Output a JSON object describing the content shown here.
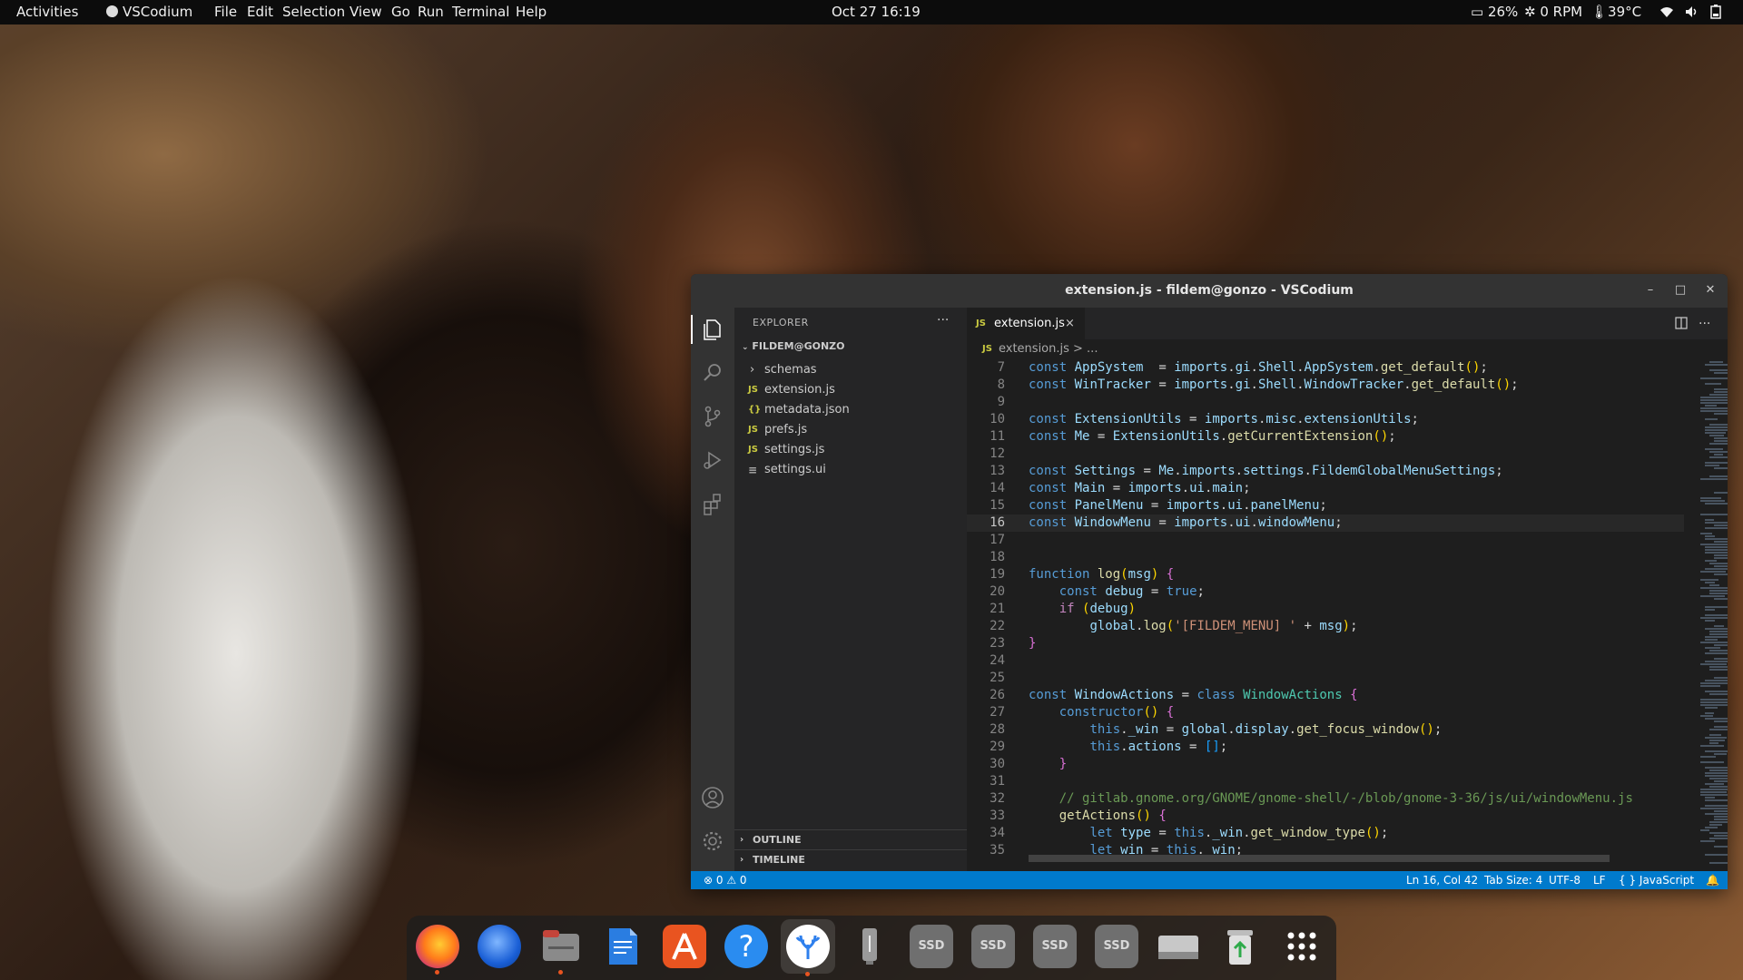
{
  "topbar": {
    "activities": "Activities",
    "app_name": "VSCodium",
    "menu": [
      "File",
      "Edit",
      "Selection",
      "View",
      "Go",
      "Run",
      "Terminal",
      "Help"
    ],
    "clock": "Oct 27  16:19",
    "battery": "26%",
    "fan": "0 RPM",
    "temp": "39°C"
  },
  "window": {
    "title": "extension.js - fildem@gonzo - VSCodium"
  },
  "sidebar": {
    "header": "EXPLORER",
    "more": "···",
    "folder": "FILDEM@GONZO",
    "items": [
      {
        "icon": "›",
        "label": "schemas",
        "type": "folder"
      },
      {
        "icon": "JS",
        "label": "extension.js",
        "type": "js"
      },
      {
        "icon": "{}",
        "label": "metadata.json",
        "type": "json"
      },
      {
        "icon": "JS",
        "label": "prefs.js",
        "type": "js"
      },
      {
        "icon": "JS",
        "label": "settings.js",
        "type": "js"
      },
      {
        "icon": "≡",
        "label": "settings.ui",
        "type": "ui"
      }
    ],
    "outline": "OUTLINE",
    "timeline": "TIMELINE"
  },
  "tabs": [
    {
      "icon": "JS",
      "label": "extension.js",
      "close": "×"
    }
  ],
  "breadcrumb": {
    "icon": "JS",
    "text": "extension.js > ..."
  },
  "editor": {
    "current_line": 16,
    "lines": [
      {
        "no": "7",
        "code": "const AppSystem  = imports.gi.Shell.AppSystem.get_default();"
      },
      {
        "no": "8",
        "code": "const WinTracker = imports.gi.Shell.WindowTracker.get_default();"
      },
      {
        "no": "9",
        "code": ""
      },
      {
        "no": "10",
        "code": "const ExtensionUtils = imports.misc.extensionUtils;"
      },
      {
        "no": "11",
        "code": "const Me = ExtensionUtils.getCurrentExtension();"
      },
      {
        "no": "12",
        "code": ""
      },
      {
        "no": "13",
        "code": "const Settings = Me.imports.settings.FildemGlobalMenuSettings;"
      },
      {
        "no": "14",
        "code": "const Main = imports.ui.main;"
      },
      {
        "no": "15",
        "code": "const PanelMenu = imports.ui.panelMenu;"
      },
      {
        "no": "16",
        "code": "const WindowMenu = imports.ui.windowMenu;"
      },
      {
        "no": "17",
        "code": ""
      },
      {
        "no": "18",
        "code": ""
      },
      {
        "no": "19",
        "code": "function log(msg) {"
      },
      {
        "no": "20",
        "code": "    const debug = true;"
      },
      {
        "no": "21",
        "code": "    if (debug)"
      },
      {
        "no": "22",
        "code": "        global.log('[FILDEM_MENU] ' + msg);"
      },
      {
        "no": "23",
        "code": "}"
      },
      {
        "no": "24",
        "code": ""
      },
      {
        "no": "25",
        "code": ""
      },
      {
        "no": "26",
        "code": "const WindowActions = class WindowActions {"
      },
      {
        "no": "27",
        "code": "    constructor() {"
      },
      {
        "no": "28",
        "code": "        this._win = global.display.get_focus_window();"
      },
      {
        "no": "29",
        "code": "        this.actions = [];"
      },
      {
        "no": "30",
        "code": "    }"
      },
      {
        "no": "31",
        "code": ""
      },
      {
        "no": "32",
        "code": "    // gitlab.gnome.org/GNOME/gnome-shell/-/blob/gnome-3-36/js/ui/windowMenu.js"
      },
      {
        "no": "33",
        "code": "    getActions() {"
      },
      {
        "no": "34",
        "code": "        let type = this._win.get_window_type();"
      },
      {
        "no": "35",
        "code": "        let win = this._win;"
      }
    ]
  },
  "statusbar": {
    "problems": "⊗ 0 ⚠ 0",
    "position": "Ln 16, Col 42",
    "tab_size": "Tab Size: 4",
    "encoding": "UTF-8",
    "eol": "LF",
    "language": "{ } JavaScript"
  },
  "dock": {
    "items": [
      {
        "name": "firefox",
        "running": true
      },
      {
        "name": "thunderbird",
        "running": false
      },
      {
        "name": "files",
        "running": true
      },
      {
        "name": "writer",
        "running": false
      },
      {
        "name": "software",
        "running": false
      },
      {
        "name": "help",
        "running": false
      },
      {
        "name": "vscodium",
        "running": true
      },
      {
        "name": "usb-drive",
        "running": false
      },
      {
        "name": "ssd-1",
        "label": "SSD",
        "running": false
      },
      {
        "name": "ssd-2",
        "label": "SSD",
        "running": false
      },
      {
        "name": "ssd-3",
        "label": "SSD",
        "running": false
      },
      {
        "name": "ssd-4",
        "label": "SSD",
        "running": false
      },
      {
        "name": "drive",
        "running": false
      },
      {
        "name": "trash",
        "running": false
      },
      {
        "name": "app-grid",
        "running": false
      }
    ]
  }
}
